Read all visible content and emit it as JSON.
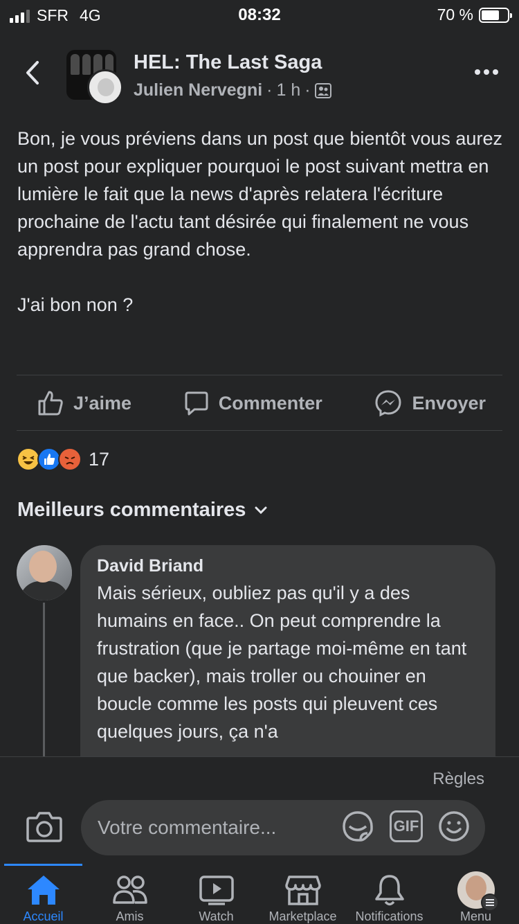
{
  "status_bar": {
    "carrier": "SFR",
    "network": "4G",
    "time": "08:32",
    "battery": "70 %",
    "battery_level": 0.7
  },
  "header": {
    "group_name": "HEL: The Last Saga",
    "author": "Julien Nervegni",
    "time_ago": "1 h",
    "separator": "·",
    "icons": {
      "back": "back-chevron-icon",
      "privacy": "group-members-icon",
      "more": "more-options-icon"
    }
  },
  "post": {
    "text": "Bon, je vous préviens dans un post que bientôt vous aurez un post pour expliquer pourquoi le post suivant mettra en lumière le fait que la news d'après relatera l'écriture prochaine de l'actu tant désirée qui finalement ne vous apprendra pas grand chose.\n\nJ'ai bon non ?"
  },
  "actions": {
    "like": "J’aime",
    "comment": "Commenter",
    "send": "Envoyer"
  },
  "reactions": {
    "types": [
      "haha",
      "like",
      "angry"
    ],
    "count": "17"
  },
  "comments": {
    "section_title": "Meilleurs commentaires",
    "items": [
      {
        "author": "David Briand",
        "text": "Mais sérieux, oubliez pas qu'il y a des humains en face.. On peut comprendre la frustration (que je partage moi-même en tant que backer), mais troller ou chouiner en boucle comme les posts qui pleuvent ces quelques jours, ça n'a"
      }
    ]
  },
  "composer": {
    "rules": "Règles",
    "placeholder": "Votre commentaire...",
    "gif_label": "GIF"
  },
  "tabbar": {
    "tabs": [
      {
        "label": "Accueil",
        "icon": "home-icon",
        "active": true
      },
      {
        "label": "Amis",
        "icon": "friends-icon"
      },
      {
        "label": "Watch",
        "icon": "watch-icon"
      },
      {
        "label": "Marketplace",
        "icon": "marketplace-icon"
      },
      {
        "label": "Notifications",
        "icon": "bell-icon"
      },
      {
        "label": "Menu",
        "icon": "menu-avatar-icon"
      }
    ]
  },
  "colors": {
    "background": "#242526",
    "bubble": "#3a3b3c",
    "accent": "#2d88ff",
    "muted": "#b0b3b8"
  }
}
